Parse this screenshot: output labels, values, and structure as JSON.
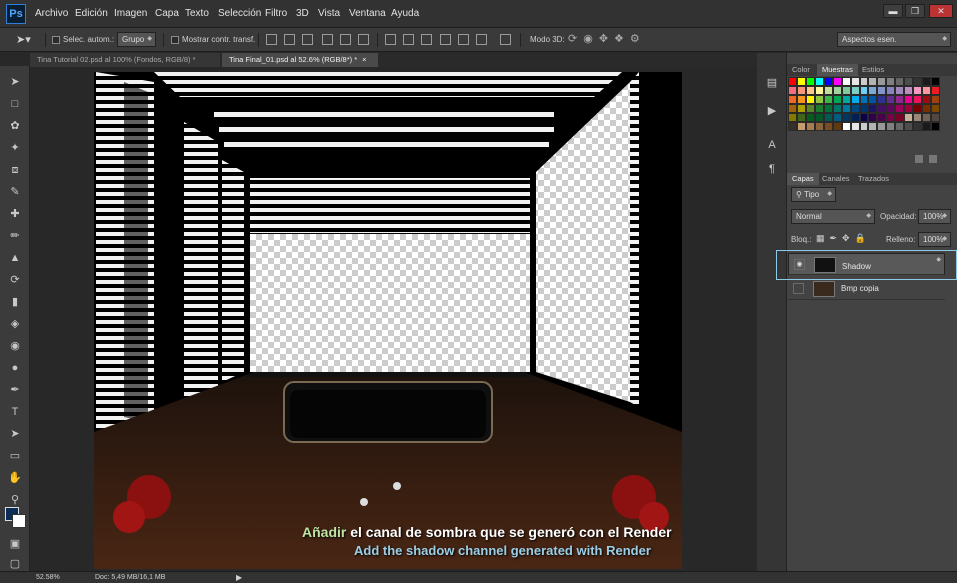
{
  "app": {
    "logo": "Ps"
  },
  "menu": [
    "Archivo",
    "Edición",
    "Imagen",
    "Capa",
    "Texto",
    "Selección",
    "Filtro",
    "3D",
    "Vista",
    "Ventana",
    "Ayuda"
  ],
  "options": {
    "auto_select_label": "Selec. autom.:",
    "group_value": "Grupo",
    "show_transform_label": "Mostrar contr. transf.",
    "mode_3d_label": "Modo 3D:",
    "workspace_value": "Aspectos esen."
  },
  "tabs": [
    {
      "label": "Tina Tutorial 02.psd al 100% (Fondos, RGB/8) *"
    },
    {
      "label": "Tina Final_01.psd al 52.6% (RGB/8*) *"
    }
  ],
  "color_panel": {
    "tabs": [
      "Color",
      "Muestras",
      "Estilos"
    ],
    "active": "Muestras",
    "swatches": [
      "#ff0000",
      "#ffff00",
      "#00ff00",
      "#00ffff",
      "#0000ff",
      "#ff00ff",
      "#ffffff",
      "#e6e6e6",
      "#cccccc",
      "#b3b3b3",
      "#999999",
      "#808080",
      "#666666",
      "#4d4d4d",
      "#333333",
      "#1a1a1a",
      "#000000",
      "#f26d7d",
      "#f7977a",
      "#fdc68a",
      "#fff79a",
      "#c4df9b",
      "#a3d39c",
      "#82ca9d",
      "#7bcdc8",
      "#6ecff6",
      "#7ea7d8",
      "#8493ca",
      "#8882be",
      "#a187be",
      "#bc8dbf",
      "#f49ac2",
      "#f6989d",
      "#ed1c24",
      "#f26522",
      "#f7941d",
      "#fff200",
      "#8dc63f",
      "#39b54a",
      "#00a651",
      "#00a99d",
      "#00aeef",
      "#0072bc",
      "#0054a6",
      "#2e3192",
      "#662d91",
      "#92278f",
      "#ec008c",
      "#ed145b",
      "#9e0b0f",
      "#a0410d",
      "#a36209",
      "#aba000",
      "#598527",
      "#1a7b30",
      "#007236",
      "#00746b",
      "#0076a3",
      "#004a80",
      "#003471",
      "#1b1464",
      "#440e62",
      "#630460",
      "#9e005d",
      "#9e0039",
      "#790000",
      "#7b2e00",
      "#7d4900",
      "#827b00",
      "#406618",
      "#005e20",
      "#005826",
      "#005952",
      "#005b7f",
      "#003663",
      "#002157",
      "#0d004c",
      "#32004b",
      "#4b0049",
      "#7b0046",
      "#7a0026",
      "#c7b299",
      "#998675",
      "#736357",
      "#534741",
      "#37302a",
      "#c69c6d",
      "#a67c52",
      "#8c6239",
      "#754c24",
      "#603913",
      "#ffffff",
      "#e6e6e6",
      "#cccccc",
      "#b3b3b3",
      "#999999",
      "#808080",
      "#666666",
      "#4d4d4d",
      "#333333",
      "#1a1a1a",
      "#000000"
    ]
  },
  "layers_panel": {
    "tabs": [
      "Capas",
      "Canales",
      "Trazados"
    ],
    "active": "Capas",
    "filter_label": "Tipo",
    "blend_mode": "Normal",
    "opacity_label": "Opacidad:",
    "opacity_value": "100%",
    "lock_label": "Bloq.:",
    "fill_label": "Relleno:",
    "fill_value": "100%",
    "layers": [
      {
        "name": "Shadow",
        "visible": true,
        "selected": true
      },
      {
        "name": "Bmp copia",
        "visible": false,
        "selected": false
      }
    ]
  },
  "subtitles": {
    "line1_prefix": "Añadir",
    "line1_rest": "el canal de sombra que se generó con el Render",
    "line2": "Add the shadow channel generated with Render"
  },
  "status": {
    "zoom": "52.58%",
    "doc": "Doc: 5,49 MB/16,1 MB"
  },
  "colors": {
    "accent": "#2e7fd6",
    "highlight_border": "#8ecbe8",
    "subtitle_prefix": "#bfe3a1",
    "subtitle_line1": "#ffffff",
    "subtitle_line2": "#9ccfe6"
  }
}
